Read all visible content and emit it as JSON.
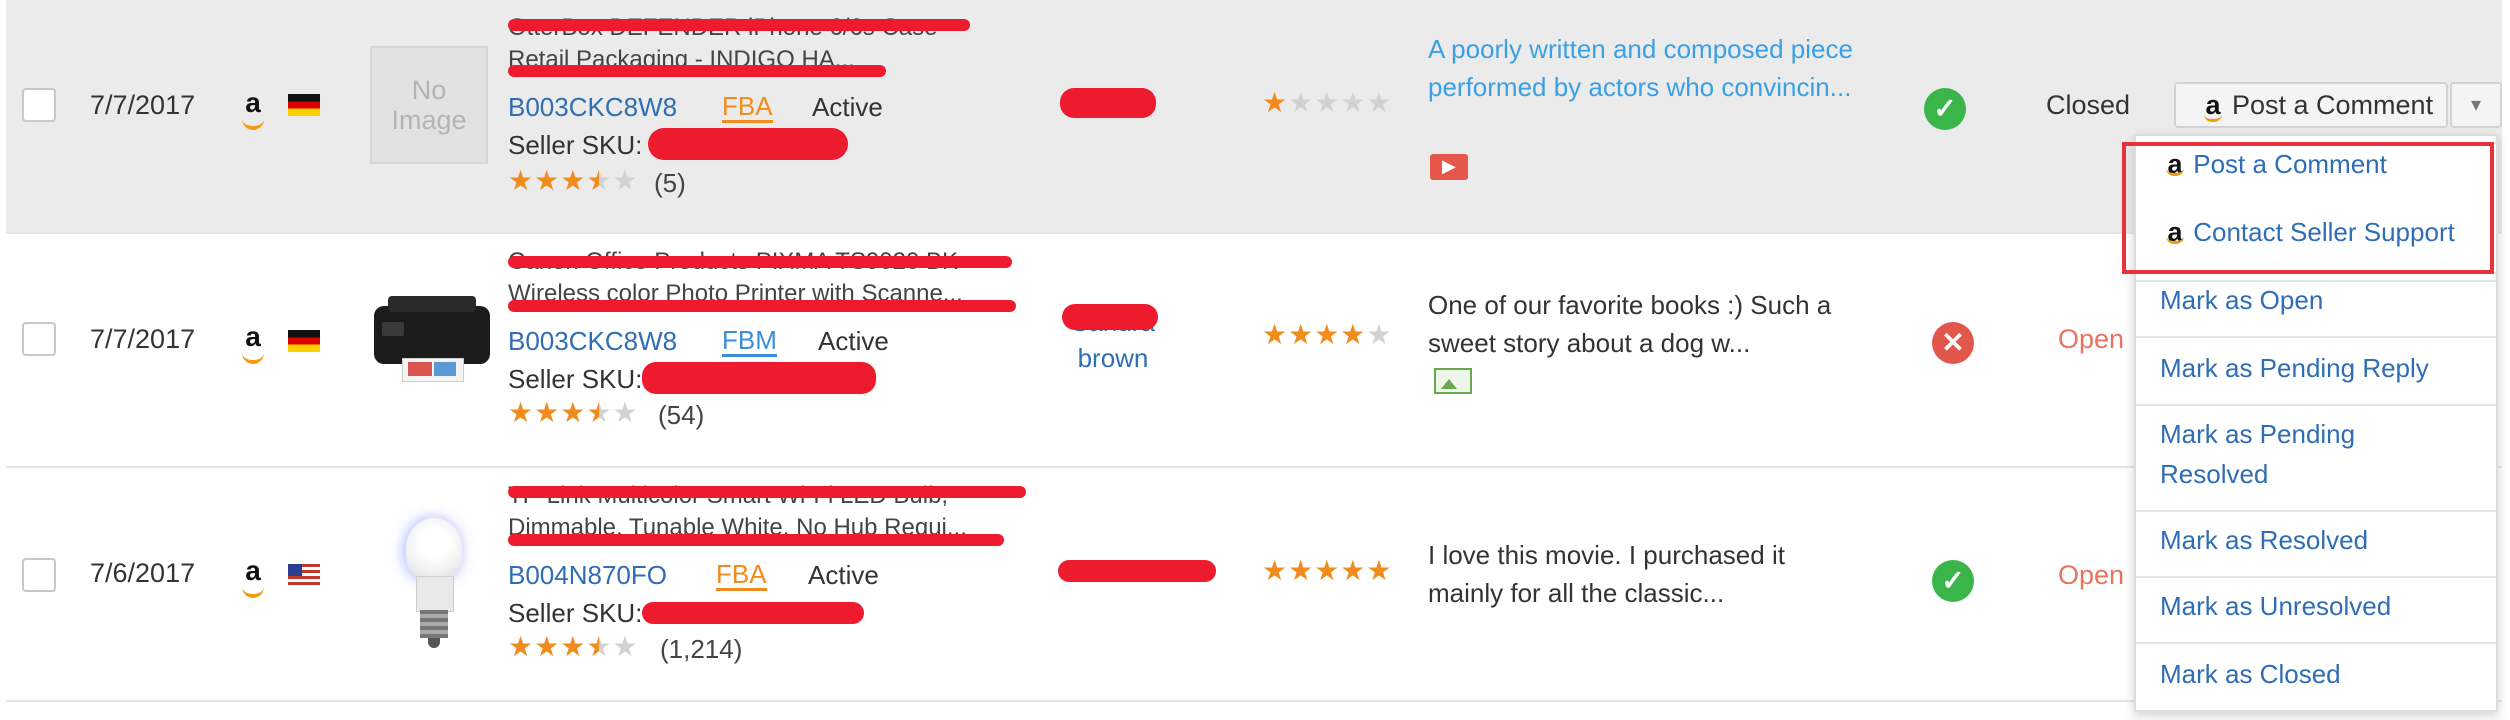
{
  "rows": [
    {
      "date": "7/7/2017",
      "marketplace_icon": "amazon-icon",
      "flag": "germany-flag",
      "image_placeholder": "No Image",
      "title_line1": "OtterBox DEFENDER iPhone 6/6s Case -",
      "title_line2": "Retail Packaging - INDIGO HA...",
      "asin": "B003CKC8W8",
      "fulfillment": "FBA",
      "listing_status": "Active",
      "sku_label": "Seller SKU:",
      "product_stars": 3.5,
      "product_stars_text": "★★★★★",
      "review_count": "(5)",
      "customer": "",
      "review_stars": 1,
      "review_stars_text": "★★★★★",
      "review_text": "A poorly written and composed piece performed by actors who convincin...",
      "media_icon": "video-icon",
      "status_icon": "check-icon",
      "status_glyph": "✓",
      "state": "Closed",
      "action_label": "Post a Comment",
      "action_caret": "▾"
    },
    {
      "date": "7/7/2017",
      "marketplace_icon": "amazon-icon",
      "flag": "germany-flag",
      "title_line1": "Canon Office Products PIXMA TS9020 BK",
      "title_line2": "Wireless color Photo Printer with Scanne...",
      "asin": "B003CKC8W8",
      "fulfillment": "FBM",
      "listing_status": "Active",
      "sku_label": "Seller SKU:",
      "product_stars": 3.5,
      "product_stars_text": "★★★★★",
      "review_count": "(54)",
      "customer_line1": "Sandra",
      "customer_line2": "brown",
      "review_stars": 4,
      "review_stars_text": "★★★★★",
      "review_text": "One of our favorite books :) Such a sweet story about a dog w...",
      "media_icon": "image-icon",
      "status_icon": "x-icon",
      "status_glyph": "✕",
      "state": "Open"
    },
    {
      "date": "7/6/2017",
      "marketplace_icon": "amazon-icon",
      "flag": "us-flag",
      "title_line1": "TP-Link Multicolor Smart Wi-Fi LED Bulb,",
      "title_line2": "Dimmable, Tunable White, No Hub Requi...",
      "asin": "B004N870FO",
      "fulfillment": "FBA",
      "listing_status": "Active",
      "sku_label": "Seller SKU:",
      "product_stars": 3.5,
      "product_stars_text": "★★★★★",
      "review_count": "(1,214)",
      "customer": "",
      "review_stars": 5,
      "review_stars_text": "★★★★★",
      "review_text": "I love this movie. I purchased it mainly for all the classic...",
      "status_icon": "check-icon",
      "status_glyph": "✓",
      "state": "Open"
    }
  ],
  "amazon_glyph": "a",
  "dropdown": {
    "post_comment": "Post a Comment",
    "contact_support": "Contact Seller Support",
    "mark_open": "Mark as Open",
    "mark_pending_reply": "Mark as Pending Reply",
    "mark_pending_resolved_1": "Mark as Pending",
    "mark_pending_resolved_2": "Resolved",
    "mark_resolved": "Mark as Resolved",
    "mark_unresolved": "Mark as Unresolved",
    "mark_closed": "Mark as Closed"
  },
  "colors": {
    "accent_orange": "#f08c1e",
    "link_blue": "#2f6db5",
    "highlight_red": "#e8303f",
    "ok_green": "#3ab54a",
    "error_red": "#e2574c"
  }
}
